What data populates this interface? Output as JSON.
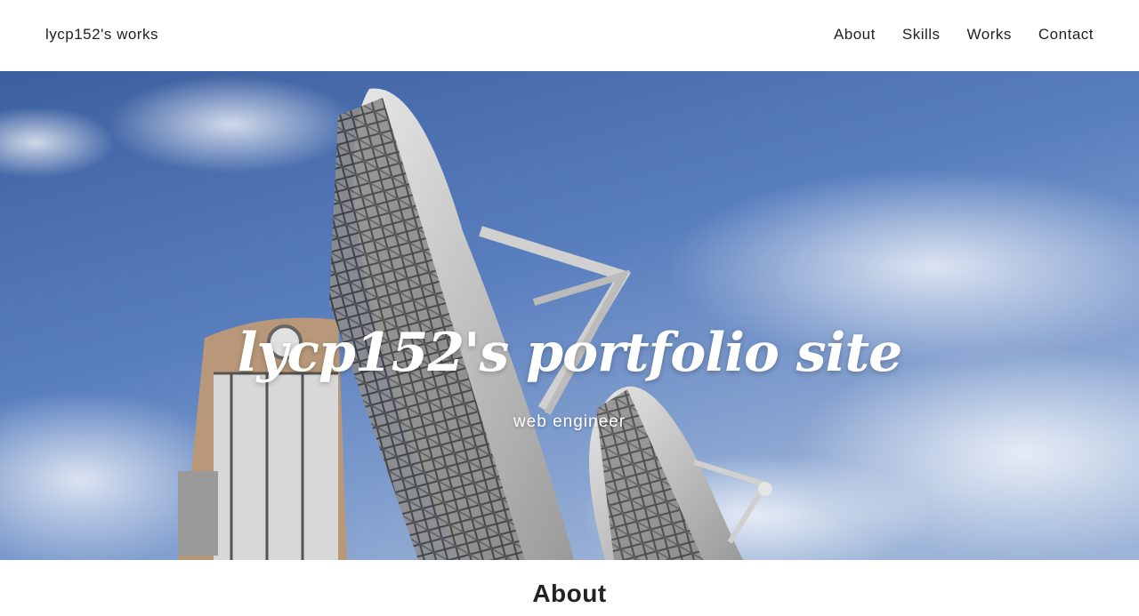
{
  "header": {
    "site_title": "lycp152's works",
    "nav": [
      "About",
      "Skills",
      "Works",
      "Contact"
    ]
  },
  "hero": {
    "title": "lycp152's portfolio site",
    "subtitle": "web engineer",
    "image_alt": "satellite dish antennas under a blue sky"
  },
  "about": {
    "heading": "About"
  },
  "colors": {
    "sky": "#4a6fb0",
    "header_bg": "#ffffff",
    "text": "#222222"
  }
}
